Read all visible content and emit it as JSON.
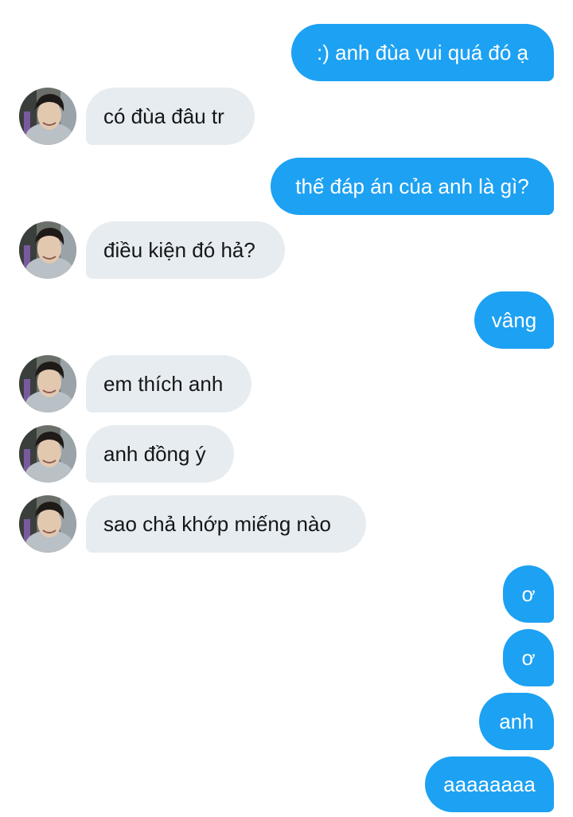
{
  "conversation": {
    "avatar_icon": "user-profile-photo-icon",
    "colors": {
      "outgoing_bubble": "#1da1f2",
      "outgoing_text": "#ffffff",
      "incoming_bubble": "#e6ecf0",
      "incoming_text": "#14171a"
    },
    "messages": [
      {
        "direction": "outgoing",
        "text": ":) anh đùa vui quá đó ạ"
      },
      {
        "direction": "incoming",
        "text": "có đùa đâu tr"
      },
      {
        "direction": "outgoing",
        "text": "thế đáp án của anh là gì?"
      },
      {
        "direction": "incoming",
        "text": "điều kiện đó hả?"
      },
      {
        "direction": "outgoing",
        "text": "vâng"
      },
      {
        "direction": "incoming",
        "text": "em thích anh"
      },
      {
        "direction": "incoming",
        "text": "anh đồng ý"
      },
      {
        "direction": "incoming",
        "text": "sao chả khớp miếng nào"
      },
      {
        "direction": "outgoing",
        "text": "ơ"
      },
      {
        "direction": "outgoing",
        "text": "ơ"
      },
      {
        "direction": "outgoing",
        "text": "anh"
      },
      {
        "direction": "outgoing",
        "text": "aaaaaaaa"
      }
    ]
  }
}
